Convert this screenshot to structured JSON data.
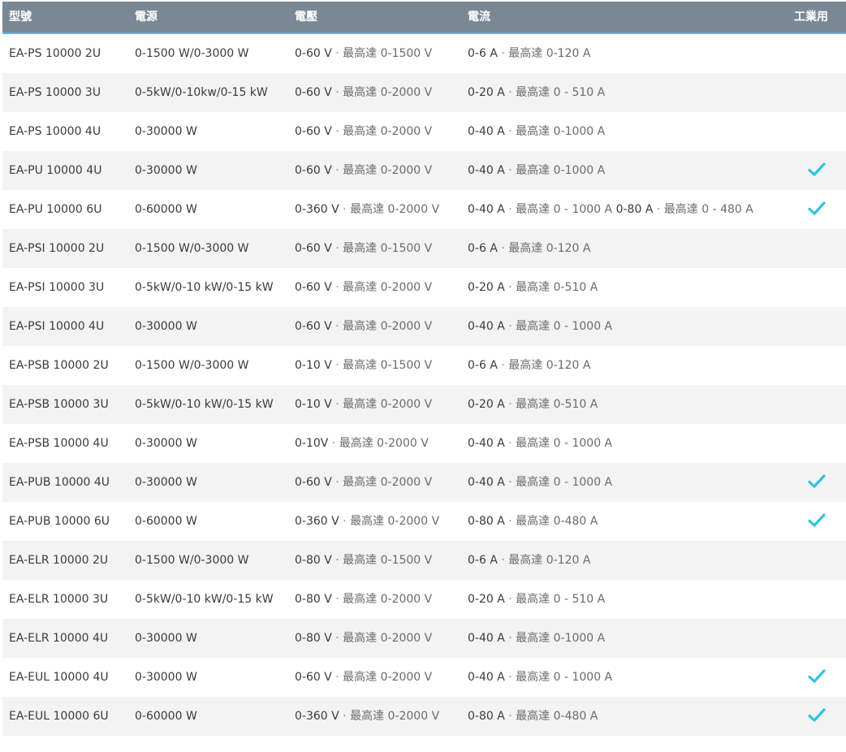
{
  "header": {
    "model": "型號",
    "power": "電源",
    "voltage": "電壓",
    "current": "電流",
    "industrial": "工業用"
  },
  "colors": {
    "header_bg": "#7a8895",
    "header_underline": "#3ec7dc",
    "row_alt_bg": "#f3f3f3",
    "check": "#2ec4dd"
  },
  "rows": [
    {
      "model": "EA-PS 10000 2U",
      "power": "0-1500 W/0-3000 W",
      "voltage": "0-60 V",
      "voltage_max": "最高達 0-1500 V",
      "current": "0-6 A",
      "current_max": "最高達 0-120 A",
      "current_extra": "",
      "current_extra_max": "",
      "industrial": false
    },
    {
      "model": "EA-PS 10000 3U",
      "power": "0-5kW/0-10kw/0-15 kW",
      "voltage": "0-60 V",
      "voltage_max": "最高達 0-2000 V",
      "current": "0-20 A",
      "current_max": "最高達 0 - 510 A",
      "current_extra": "",
      "current_extra_max": "",
      "industrial": false
    },
    {
      "model": "EA-PS 10000 4U",
      "power": "0-30000 W",
      "voltage": "0-60 V",
      "voltage_max": "最高達 0-2000 V",
      "current": "0-40 A",
      "current_max": "最高達 0-1000 A",
      "current_extra": "",
      "current_extra_max": "",
      "industrial": false
    },
    {
      "model": "EA-PU 10000 4U",
      "power": "0-30000 W",
      "voltage": "0-60 V",
      "voltage_max": "最高達 0-2000 V",
      "current": "0-40 A",
      "current_max": "最高達 0-1000 A",
      "current_extra": "",
      "current_extra_max": "",
      "industrial": true
    },
    {
      "model": "EA-PU 10000 6U",
      "power": "0-60000 W",
      "voltage": "0-360 V",
      "voltage_max": "最高達 0-2000 V",
      "current": "0-40 A",
      "current_max": "最高達 0 - 1000 A",
      "current_extra": "0-80 A",
      "current_extra_max": "最高達 0 - 480 A",
      "industrial": true
    },
    {
      "model": "EA-PSI 10000 2U",
      "power": "0-1500 W/0-3000 W",
      "voltage": "0-60 V",
      "voltage_max": "最高達 0-1500 V",
      "current": "0-6 A",
      "current_max": "最高達 0-120 A",
      "current_extra": "",
      "current_extra_max": "",
      "industrial": false
    },
    {
      "model": "EA-PSI 10000 3U",
      "power": "0-5kW/0-10 kW/0-15 kW",
      "voltage": "0-60 V",
      "voltage_max": "最高達 0-2000 V",
      "current": "0-20 A",
      "current_max": "最高達 0-510 A",
      "current_extra": "",
      "current_extra_max": "",
      "industrial": false
    },
    {
      "model": "EA-PSI 10000 4U",
      "power": "0-30000 W",
      "voltage": "0-60 V",
      "voltage_max": "最高達 0-2000 V",
      "current": "0-40 A",
      "current_max": "最高達 0 - 1000 A",
      "current_extra": "",
      "current_extra_max": "",
      "industrial": false
    },
    {
      "model": "EA-PSB 10000 2U",
      "power": "0-1500 W/0-3000 W",
      "voltage": "0-10 V",
      "voltage_max": "最高達 0-1500 V",
      "current": "0-6 A",
      "current_max": "最高達 0-120 A",
      "current_extra": "",
      "current_extra_max": "",
      "industrial": false
    },
    {
      "model": "EA-PSB 10000 3U",
      "power": "0-5kW/0-10 kW/0-15 kW",
      "voltage": "0-10 V",
      "voltage_max": "最高達 0-2000 V",
      "current": "0-20 A",
      "current_max": "最高達 0-510 A",
      "current_extra": "",
      "current_extra_max": "",
      "industrial": false
    },
    {
      "model": "EA-PSB 10000 4U",
      "power": "0-30000 W",
      "voltage": "0-10V",
      "voltage_max": "最高達 0-2000 V",
      "current": "0-40 A",
      "current_max": "最高達 0 - 1000 A",
      "current_extra": "",
      "current_extra_max": "",
      "industrial": false
    },
    {
      "model": "EA-PUB 10000 4U",
      "power": "0-30000 W",
      "voltage": "0-60 V",
      "voltage_max": "最高達 0-2000 V",
      "current": "0-40 A",
      "current_max": "最高達 0 - 1000 A",
      "current_extra": "",
      "current_extra_max": "",
      "industrial": true
    },
    {
      "model": "EA-PUB 10000 6U",
      "power": "0-60000 W",
      "voltage": "0-360 V",
      "voltage_max": "最高達 0-2000 V",
      "current": "0-80 A",
      "current_max": "最高達 0-480 A",
      "current_extra": "",
      "current_extra_max": "",
      "industrial": true
    },
    {
      "model": "EA-ELR 10000 2U",
      "power": "0-1500 W/0-3000 W",
      "voltage": "0-80 V",
      "voltage_max": "最高達 0-1500 V",
      "current": "0-6 A",
      "current_max": "最高達 0-120 A",
      "current_extra": "",
      "current_extra_max": "",
      "industrial": false
    },
    {
      "model": "EA-ELR 10000 3U",
      "power": "0-5kW/0-10 kW/0-15 kW",
      "voltage": "0-80 V",
      "voltage_max": "最高達 0-2000 V",
      "current": "0-20 A",
      "current_max": "最高達 0 - 510 A",
      "current_extra": "",
      "current_extra_max": "",
      "industrial": false
    },
    {
      "model": "EA-ELR 10000 4U",
      "power": "0-30000 W",
      "voltage": "0-80 V",
      "voltage_max": "最高達 0-2000 V",
      "current": "0-40 A",
      "current_max": "最高達 0-1000 A",
      "current_extra": "",
      "current_extra_max": "",
      "industrial": false
    },
    {
      "model": "EA-EUL 10000 4U",
      "power": "0-30000 W",
      "voltage": "0-60 V",
      "voltage_max": "最高達 0-2000 V",
      "current": "0-40 A",
      "current_max": "最高達 0 - 1000 A",
      "current_extra": "",
      "current_extra_max": "",
      "industrial": true
    },
    {
      "model": "EA-EUL 10000 6U",
      "power": "0-60000 W",
      "voltage": "0-360 V",
      "voltage_max": "最高達 0-2000 V",
      "current": "0-80 A",
      "current_max": "最高達 0-480 A",
      "current_extra": "",
      "current_extra_max": "",
      "industrial": true
    }
  ]
}
